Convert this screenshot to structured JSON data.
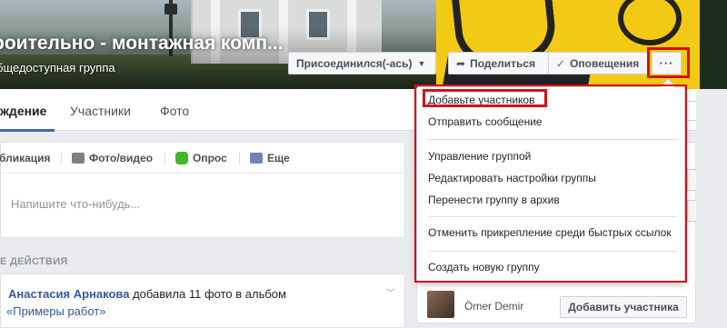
{
  "group": {
    "title": "роительно - монтажная комп...",
    "type": "бщедоступная группа"
  },
  "header_buttons": {
    "joined": "Присоединился(-ась)",
    "share": "Поделиться",
    "notifications": "Оповещения",
    "more": "···"
  },
  "tabs": {
    "discussion": "ждение",
    "members": "Участники",
    "photos": "Фото"
  },
  "composer": {
    "publication": "бликация",
    "photo_video": "Фото/видео",
    "poll": "Опрос",
    "more": "Еще",
    "placeholder": "Напишите что-нибудь..."
  },
  "section": {
    "recent_activity": "Е ДЕЙСТВИЯ"
  },
  "feed": {
    "author": "Анастасия Арнакова",
    "action": " добавила 11 фото в альбом",
    "album": "«Примеры работ»"
  },
  "sidebar": {
    "member_name": "Ömer Demir",
    "add_member_button": "Добавить участника"
  },
  "dropdown": {
    "items": [
      "Добавьте участников",
      "Отправить сообщение",
      "Управление группой",
      "Редактировать настройки группы",
      "Перенести группу в архив",
      "Отменить прикрепление среди быстрых ссылок",
      "Создать новую группу"
    ]
  },
  "colors": {
    "accent": "#4267b2",
    "highlight_box": "#d3121a",
    "cover_yellow": "#f2c915"
  }
}
